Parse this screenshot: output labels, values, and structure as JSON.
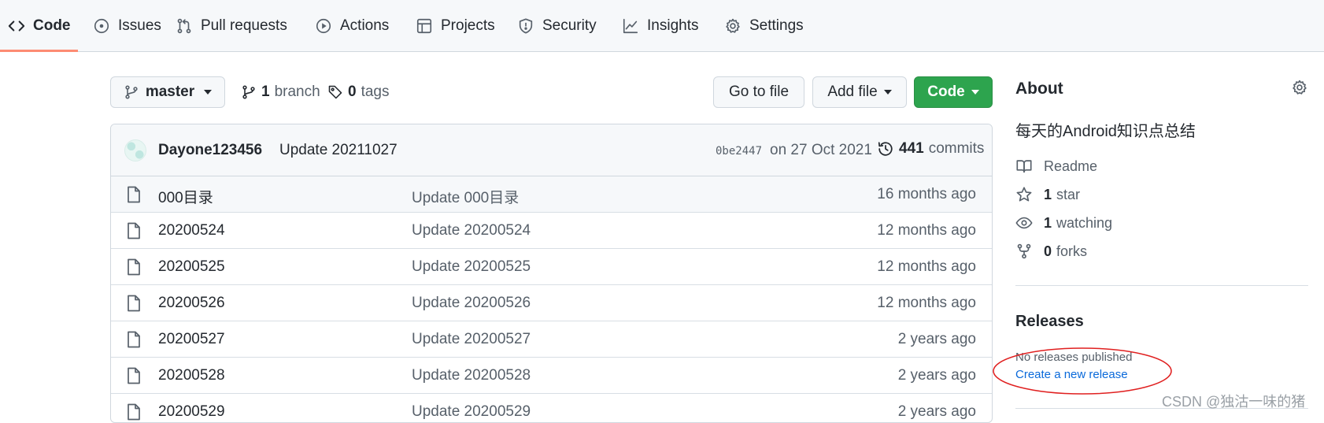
{
  "repo_nav": {
    "tabs": [
      {
        "label": "Code",
        "icon": "code-icon",
        "active": true
      },
      {
        "label": "Issues",
        "icon": "issue-icon"
      },
      {
        "label": "Pull requests",
        "icon": "pull-request-icon"
      },
      {
        "label": "Actions",
        "icon": "play-icon"
      },
      {
        "label": "Projects",
        "icon": "table-icon"
      },
      {
        "label": "Security",
        "icon": "shield-icon"
      },
      {
        "label": "Insights",
        "icon": "graph-icon"
      },
      {
        "label": "Settings",
        "icon": "gear-icon"
      }
    ]
  },
  "toolbar": {
    "branch_name": "master",
    "branch_count": "1",
    "branch_label": "branch",
    "tag_count": "0",
    "tag_label": "tags",
    "goto_file": "Go to file",
    "add_file": "Add file",
    "code_button": "Code"
  },
  "commit": {
    "author": "Dayone123456",
    "message": "Update 20211027",
    "sha": "0be2447",
    "date": "on 27 Oct 2021",
    "commit_count": "441",
    "commit_label": "commits"
  },
  "files": [
    {
      "name": "000目录",
      "message": "Update 000目录",
      "age": "16 months ago"
    },
    {
      "name": "20200524",
      "message": "Update 20200524",
      "age": "12 months ago"
    },
    {
      "name": "20200525",
      "message": "Update 20200525",
      "age": "12 months ago"
    },
    {
      "name": "20200526",
      "message": "Update 20200526",
      "age": "12 months ago"
    },
    {
      "name": "20200527",
      "message": "Update 20200527",
      "age": "2 years ago"
    },
    {
      "name": "20200528",
      "message": "Update 20200528",
      "age": "2 years ago"
    },
    {
      "name": "20200529",
      "message": "Update 20200529",
      "age": "2 years ago"
    }
  ],
  "about": {
    "title": "About",
    "description": "每天的Android知识点总结",
    "readme": "Readme",
    "stars_count": "1",
    "stars_label": "star",
    "watching_count": "1",
    "watching_label": "watching",
    "forks_count": "0",
    "forks_label": "forks"
  },
  "releases": {
    "title": "Releases",
    "none_text": "No releases published",
    "create_link": "Create a new release"
  },
  "watermark": "CSDN @独沽一味的猪",
  "colors": {
    "accent_underline": "#fd8c73",
    "code_button_green": "#2da44e",
    "link_blue": "#0969da",
    "annotation_red": "#e02020"
  }
}
